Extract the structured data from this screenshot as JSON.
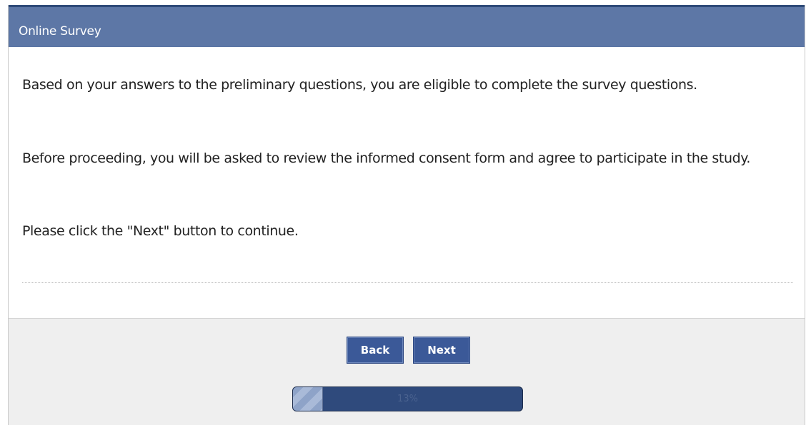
{
  "header": {
    "title": "Online Survey"
  },
  "content": {
    "paragraphs": [
      "Based on your answers to the preliminary questions, you are eligible to complete the survey questions.",
      "Before proceeding, you will be asked to review the informed consent form and agree to participate in the study.",
      "Please click the \"Next\" button to continue."
    ]
  },
  "footer": {
    "back_label": "Back",
    "next_label": "Next"
  },
  "progress": {
    "value": 0.13,
    "label": "13%"
  },
  "colors": {
    "header_bg": "#5d77a6",
    "button_bg": "#3b5998",
    "progress_bg": "#2f4a7c"
  }
}
